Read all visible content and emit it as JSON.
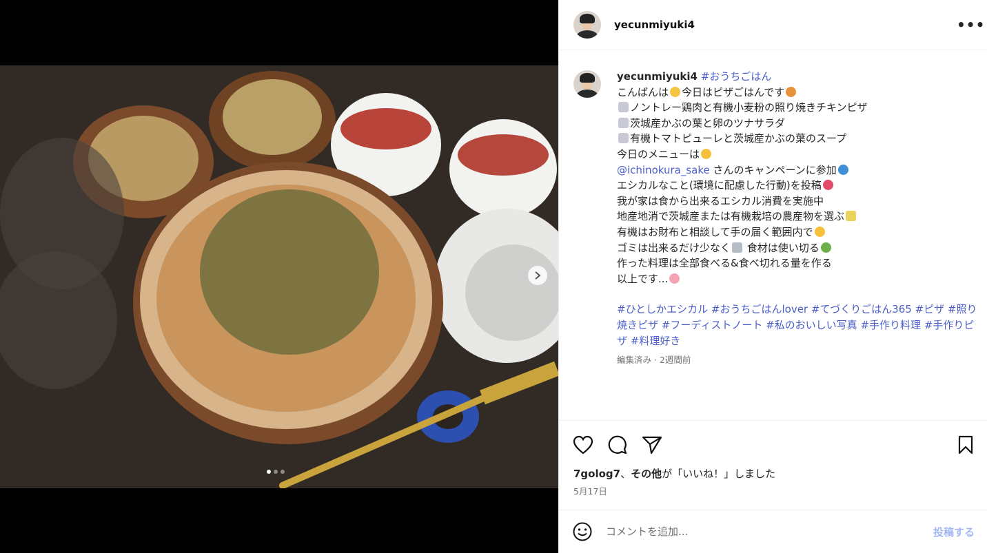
{
  "colors": {
    "link": "#4a5ec9",
    "post_disabled": "#a5b7f3",
    "muted": "#737373"
  },
  "media": {
    "image_alt": "ピザ、サラダ、スープの食卓写真",
    "slide_count": 3,
    "active_slide": 1
  },
  "header": {
    "username": "yecunmiyuki4",
    "more_icon": "more-horizontal-icon"
  },
  "caption": {
    "username": "yecunmiyuki4",
    "first_tag": "#おうちごはん",
    "lines": [
      "こんばんは",
      "今日はピザごはんです",
      "ノントレー鶏肉と有機小麦粉の照り焼きチキンピザ",
      "茨城産かぶの葉と卵のツナサラダ",
      "有機トマトピューレと茨城産かぶの葉のスープ",
      "今日のメニューは",
      "@ichinokura_sake",
      "さんのキャンペーンに参加",
      "エシカルなこと(環境に配慮した行動)を投稿",
      "我が家は食から出来るエシカル消費を実施中",
      "地産地消で茨城産または有機栽培の農産物を選ぶ",
      "有機はお財布と相談して手の届く範囲内で",
      "ゴミは出来るだけ少なく",
      "食材は使い切る",
      "作った料理は全部食べる&食べ切れる量を作る",
      "以上です..."
    ],
    "hashtags": [
      "#ひとしかエシカル",
      "#おうちごはんlover",
      "#てづくりごはん365",
      "#ピザ",
      "#照り焼きピザ",
      "#フーディストノート",
      "#私のおいしい写真",
      "#手作り料理",
      "#手作りピザ",
      "#料理好き"
    ],
    "meta": "編集済み · 2週間前"
  },
  "actions": {
    "likes_user": "7golog7",
    "likes_sep": "、",
    "likes_others": "その他",
    "likes_suffix": "が「いいね！」しました",
    "date": "5月17日"
  },
  "comment": {
    "placeholder": "コメントを追加...",
    "post_label": "投稿する"
  }
}
